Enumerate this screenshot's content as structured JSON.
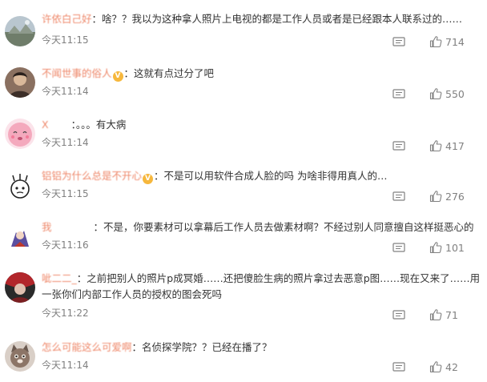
{
  "comments": [
    {
      "user": "许依白己好",
      "vip": false,
      "text": "：啥？？我以为这种拿人照片上电视的都是工作人员或者是已经跟本人联系过的……",
      "time": "今天11:15",
      "likes": "714",
      "avatar_icon": "landscape-avatar-icon"
    },
    {
      "user": "不闻世事的俗人",
      "vip": true,
      "text": "：这就有点过分了吧",
      "time": "今天11:14",
      "likes": "550",
      "avatar_icon": "person-avatar-icon"
    },
    {
      "user": "X",
      "vip": false,
      "text": "：。。。有大病",
      "time": "今天11:14",
      "likes": "417",
      "avatar_icon": "pink-face-avatar-icon"
    },
    {
      "user": "铝铝为什么总是不开心",
      "vip": true,
      "text": "：不是可以用软件合成人脸的吗 为啥非得用真人的…",
      "time": "今天11:15",
      "likes": "276",
      "avatar_icon": "cartoon-avatar-icon"
    },
    {
      "user": "我",
      "vip": false,
      "text": "：不是，你要素材可以拿幕后工作人员去做素材啊？不经过别人同意擅自这样挺恶心的",
      "time": "今天11:16",
      "likes": "101",
      "avatar_icon": "anime-avatar-icon"
    },
    {
      "user": "呲二二_",
      "vip": false,
      "text": "：之前把别人的照片p成冥婚……还把傻脸生病的照片拿过去恶意p图……现在又来了……用一张你们内部工作人员的授权的图会死吗",
      "time": "今天11:22",
      "likes": "71",
      "avatar_icon": "red-person-avatar-icon"
    },
    {
      "user": "怎么可能这么可爱啊",
      "vip": false,
      "text": "：名侦探学院？？已经在播了？",
      "time": "今天11:14",
      "likes": "42",
      "avatar_icon": "cat-avatar-icon"
    }
  ],
  "colors": {
    "username": "#eb7350",
    "text": "#333333",
    "meta": "#808080",
    "vip_badge": "#f6b73c"
  },
  "icons": {
    "reply": "reply-icon",
    "like": "thumbs-up-icon",
    "vip": "vip-badge-icon"
  }
}
